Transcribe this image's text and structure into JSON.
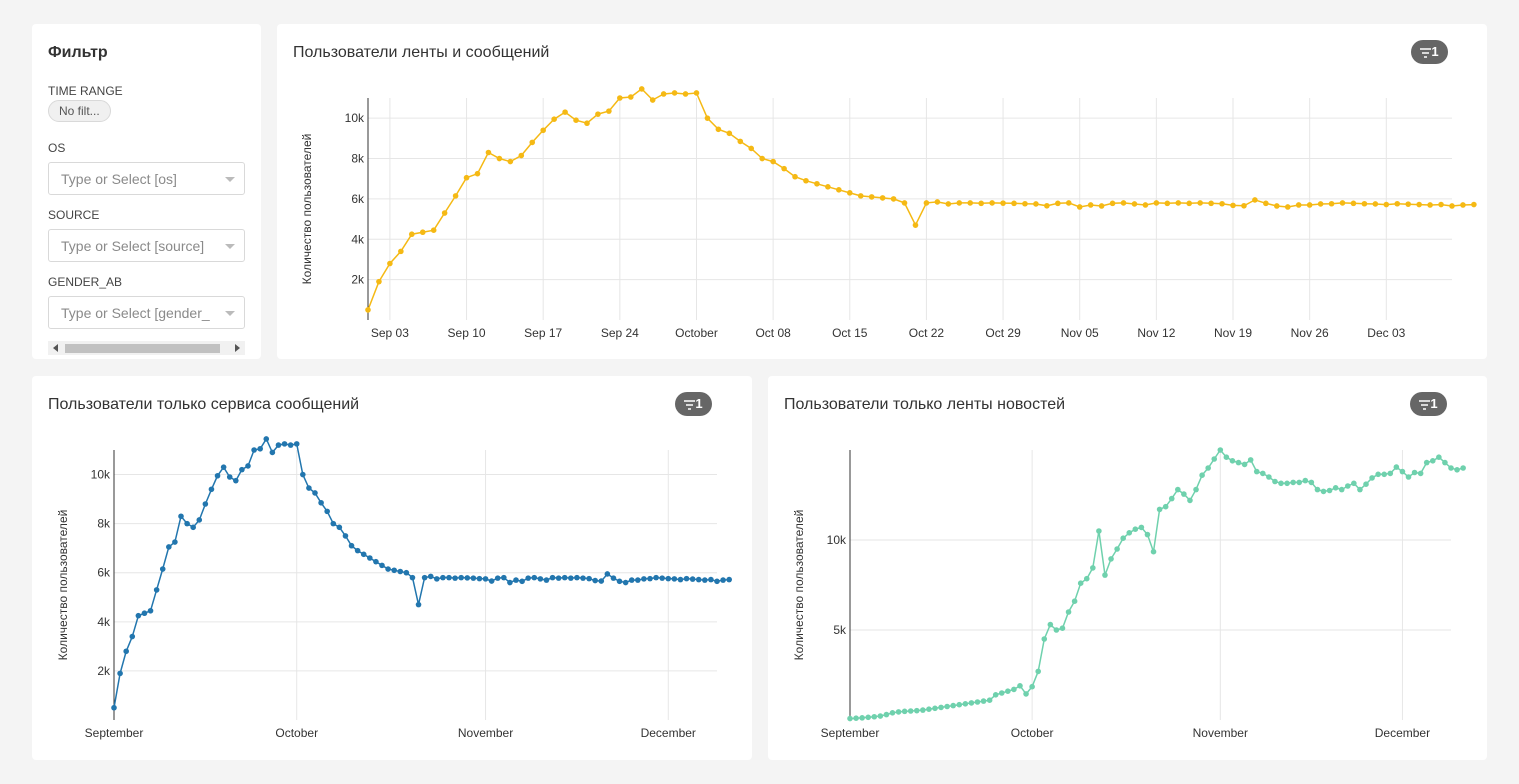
{
  "filter_panel": {
    "title": "Фильтр",
    "time_range_label": "TIME RANGE",
    "time_range_value": "No filt...",
    "os_label": "OS",
    "os_placeholder": "Type or Select [os]",
    "source_label": "SOURCE",
    "source_placeholder": "Type or Select [source]",
    "gender_label": "GENDER_AB",
    "gender_placeholder": "Type or Select [gender_"
  },
  "colors": {
    "yellow": "#f5b914",
    "blue": "#2276ae",
    "green": "#6fd1ad",
    "badge": "#666666"
  },
  "charts": {
    "feed_and_messages": {
      "title": "Пользователи ленты и сообщений",
      "badge": "1",
      "chart_data": {
        "type": "line",
        "ylabel": "Количество пользователей",
        "x_start": "2022-09-01",
        "x_end": "2022-12-09",
        "xticks": [
          "Sep 03",
          "Sep 10",
          "Sep 17",
          "Sep 24",
          "October",
          "Oct 08",
          "Oct 15",
          "Oct 22",
          "Oct 29",
          "Nov 05",
          "Nov 12",
          "Nov 19",
          "Nov 26",
          "Dec 03"
        ],
        "yticks": [
          "2k",
          "4k",
          "6k",
          "8k",
          "10k"
        ],
        "ylim": [
          0,
          11000
        ],
        "values": [
          500,
          1900,
          2800,
          3400,
          4250,
          4350,
          4450,
          5300,
          6150,
          7050,
          7250,
          8300,
          8000,
          7850,
          8150,
          8800,
          9400,
          9950,
          10300,
          9900,
          9750,
          10200,
          10350,
          11000,
          11050,
          11450,
          10900,
          11200,
          11250,
          11200,
          11250,
          10000,
          9450,
          9250,
          8850,
          8500,
          8000,
          7850,
          7500,
          7100,
          6900,
          6750,
          6600,
          6450,
          6300,
          6150,
          6100,
          6050,
          6000,
          5800,
          4700,
          5800,
          5850,
          5750,
          5800,
          5800,
          5780,
          5800,
          5790,
          5780,
          5760,
          5750,
          5660,
          5780,
          5800,
          5600,
          5700,
          5650,
          5780,
          5800,
          5750,
          5700,
          5800,
          5780,
          5800,
          5780,
          5800,
          5780,
          5760,
          5680,
          5660,
          5950,
          5780,
          5650,
          5600,
          5700,
          5700,
          5750,
          5760,
          5800,
          5780,
          5760,
          5750,
          5720,
          5760,
          5740,
          5720,
          5700,
          5720,
          5650,
          5700,
          5720
        ]
      }
    },
    "messages_only": {
      "title": "Пользователи только сервиса сообщений",
      "badge": "1",
      "chart_data": {
        "type": "line",
        "ylabel": "Количество пользователей",
        "x_start": "2022-09-01",
        "x_end": "2022-12-09",
        "xticks": [
          "September",
          "October",
          "November",
          "December"
        ],
        "yticks": [
          "2k",
          "4k",
          "6k",
          "8k",
          "10k"
        ],
        "ylim": [
          0,
          11000
        ],
        "values": [
          500,
          1900,
          2800,
          3400,
          4250,
          4350,
          4450,
          5300,
          6150,
          7050,
          7250,
          8300,
          8000,
          7850,
          8150,
          8800,
          9400,
          9950,
          10300,
          9900,
          9750,
          10200,
          10350,
          11000,
          11050,
          11450,
          10900,
          11200,
          11250,
          11200,
          11250,
          10000,
          9450,
          9250,
          8850,
          8500,
          8000,
          7850,
          7500,
          7100,
          6900,
          6750,
          6600,
          6450,
          6300,
          6150,
          6100,
          6050,
          6000,
          5800,
          4700,
          5800,
          5850,
          5750,
          5800,
          5800,
          5780,
          5800,
          5790,
          5780,
          5760,
          5750,
          5660,
          5780,
          5800,
          5600,
          5700,
          5650,
          5780,
          5800,
          5750,
          5700,
          5800,
          5780,
          5800,
          5780,
          5800,
          5780,
          5760,
          5680,
          5660,
          5950,
          5780,
          5650,
          5600,
          5700,
          5700,
          5750,
          5760,
          5800,
          5780,
          5760,
          5750,
          5720,
          5760,
          5740,
          5720,
          5700,
          5720,
          5650,
          5700,
          5720
        ]
      }
    },
    "feed_only": {
      "title": "Пользователи только ленты новостей",
      "badge": "1",
      "chart_data": {
        "type": "line",
        "ylabel": "Количество пользователей",
        "x_start": "2022-09-01",
        "x_end": "2022-12-09",
        "xticks": [
          "September",
          "October",
          "November",
          "December"
        ],
        "yticks": [
          "5k",
          "10k"
        ],
        "ylim": [
          0,
          15000
        ],
        "values": [
          80,
          100,
          120,
          150,
          180,
          220,
          300,
          400,
          450,
          480,
          500,
          520,
          550,
          600,
          650,
          700,
          750,
          800,
          850,
          900,
          950,
          1000,
          1050,
          1100,
          1400,
          1500,
          1600,
          1700,
          1900,
          1450,
          1850,
          2700,
          4500,
          5300,
          5000,
          5100,
          6000,
          6600,
          7600,
          7850,
          8450,
          10500,
          8050,
          8950,
          9500,
          10100,
          10400,
          10600,
          10700,
          10300,
          9350,
          11700,
          11850,
          12300,
          12800,
          12550,
          12200,
          12800,
          13600,
          14000,
          14500,
          15000,
          14600,
          14400,
          14300,
          14200,
          14450,
          13800,
          13700,
          13500,
          13250,
          13150,
          13150,
          13200,
          13200,
          13300,
          13200,
          12800,
          12700,
          12750,
          12900,
          12800,
          13000,
          13150,
          12800,
          13100,
          13450,
          13650,
          13650,
          13700,
          14050,
          13800,
          13500,
          13750,
          13700,
          14300,
          14400,
          14600,
          14300,
          14000,
          13900,
          14000
        ]
      }
    }
  }
}
